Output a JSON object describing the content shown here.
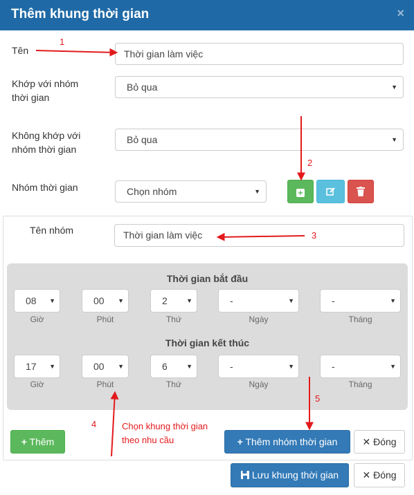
{
  "dialog": {
    "title": "Thêm khung thời gian",
    "close": "×"
  },
  "form": {
    "name_label": "Tên",
    "name_value": "Thời gian làm việc",
    "match_label": "Khớp với nhóm thời gian",
    "match_value": "Bỏ qua",
    "nomatch_label": "Không khớp với nhóm thời gian",
    "nomatch_value": "Bỏ qua",
    "group_label": "Nhóm thời gian",
    "group_value": "Chọn nhóm"
  },
  "group_form": {
    "name_label": "Tên nhóm",
    "name_value": "Thời gian làm việc",
    "start_title": "Thời gian bắt đầu",
    "end_title": "Thời gian kết thúc",
    "start": {
      "hour": "08",
      "minute": "00",
      "weekday": "2",
      "day": "-",
      "month": "-"
    },
    "end": {
      "hour": "17",
      "minute": "00",
      "weekday": "6",
      "day": "-",
      "month": "-"
    },
    "labels": {
      "hour": "Giờ",
      "minute": "Phút",
      "weekday": "Thứ",
      "day": "Ngày",
      "month": "Tháng"
    },
    "add_label": "Thêm",
    "add_group_label": "Thêm nhóm thời gian",
    "close_label": "Đóng"
  },
  "footer": {
    "save_label": "Lưu khung thời gian",
    "close_label": "Đóng"
  },
  "annotations": {
    "n1": "1",
    "n2": "2",
    "n3": "3",
    "n4": "4",
    "n5": "5",
    "note_line1": "Chọn khung thời gian",
    "note_line2": "theo nhu cầu"
  },
  "colors": {
    "header": "#1f6aa6",
    "annotation": "#e31a1c",
    "success": "#5cb85c",
    "info": "#5bc0de",
    "danger": "#d9534f",
    "primary": "#337ab7"
  }
}
